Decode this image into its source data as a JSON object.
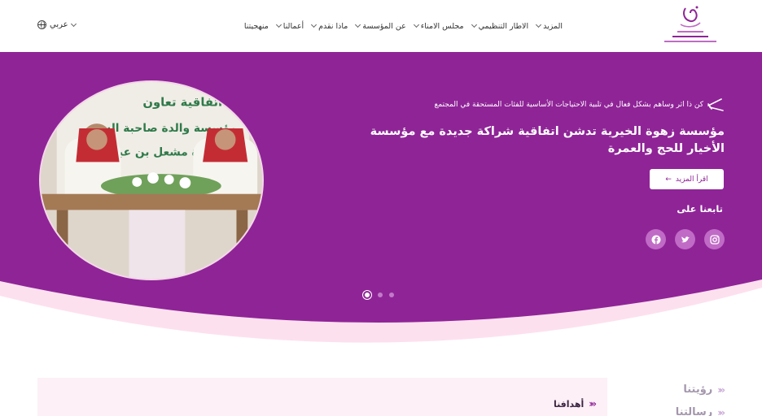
{
  "header": {
    "nav_items": [
      {
        "label": "منهجيتنا",
        "has_dropdown": false
      },
      {
        "label": "أعمالنا",
        "has_dropdown": true
      },
      {
        "label": "ماذا نقدم",
        "has_dropdown": true
      },
      {
        "label": "عن المؤسسة",
        "has_dropdown": true
      },
      {
        "label": "مجلس الامناء",
        "has_dropdown": true
      },
      {
        "label": "الاطار التنظيمي",
        "has_dropdown": true
      },
      {
        "label": "المزيد",
        "has_dropdown": true
      }
    ],
    "language_label": "عربي"
  },
  "hero": {
    "tagline": "كن ذا اثر وساهم بشكل فعال في تلبية الاحتياجات الأساسية للفئات المستحقة في المجتمع",
    "headline": "مؤسسة زهوة الخيرية تدشن اتفاقية شراكة جديدة مع مؤسسة الأخيار للحج والعمرة",
    "read_more_label": "اقرأ المزيد",
    "read_more_icon": "arrow-left-icon",
    "follow_label": "تابعنا على",
    "socials": [
      "instagram-icon",
      "twitter-icon",
      "facebook-icon"
    ],
    "slide_count": 3,
    "active_slide": 1,
    "photo_banner_lines": [
      "توقيع اتفاقية تعاون",
      "مؤسسة والدة صاحبة السمو",
      "الأميرة مشعل بن عبدالله"
    ]
  },
  "sections": {
    "goals_title": "أهدافنا",
    "side_items": [
      "رؤيتنا",
      "رسالتنا"
    ]
  },
  "colors": {
    "primary": "#8f2497",
    "accent_pink": "#f7dcec",
    "text_dark": "#333333"
  }
}
